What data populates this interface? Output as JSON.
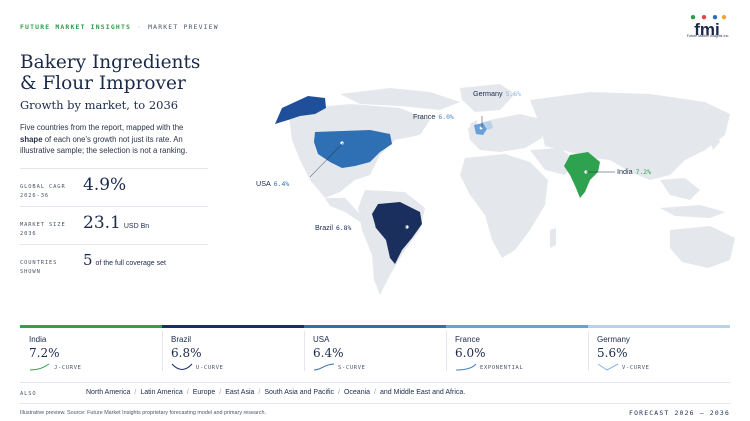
{
  "header": {
    "brand": "FUTURE MARKET INSIGHTS",
    "separator": "·",
    "section": "MARKET PREVIEW",
    "logo_text": "fmi",
    "logo_subtext": "Future Market Insights Inc."
  },
  "title": "Bakery Ingredients & Flour Improver",
  "subtitle": "Growth by market, to 2036",
  "description": {
    "part1": "Five countries from the report, mapped with the ",
    "bold": "shape",
    "part2": " of each one's growth not just its rate. An illustrative sample; the selection is not a ranking."
  },
  "stats": [
    {
      "label_line1": "GLOBAL CAGR",
      "label_line2": "2026-36",
      "value": "4.9%",
      "unit": ""
    },
    {
      "label_line1": "MARKET SIZE",
      "label_line2": "2036",
      "value": "23.1",
      "unit": "USD Bn"
    },
    {
      "label_line1": "COUNTRIES",
      "label_line2": "SHOWN",
      "value": "5",
      "unit": "of the full coverage set"
    }
  ],
  "map_labels": [
    {
      "name": "Germany",
      "value": "5.6%"
    },
    {
      "name": "France",
      "value": "6.0%"
    },
    {
      "name": "India",
      "value": "7.2%"
    },
    {
      "name": "USA",
      "value": "6.4%"
    },
    {
      "name": "Brazil",
      "value": "6.8%"
    }
  ],
  "countries": [
    {
      "name": "India",
      "value": "7.2%",
      "curve": "J-CURVE",
      "bar_color": "#2ea24e",
      "icon_color": "#2ea24e"
    },
    {
      "name": "Brazil",
      "value": "6.8%",
      "curve": "U-CURVE",
      "bar_color": "#1b2f5e",
      "icon_color": "#1b2f5e"
    },
    {
      "name": "USA",
      "value": "6.4%",
      "curve": "S-CURVE",
      "bar_color": "#2f6fb3",
      "icon_color": "#2f6fb3"
    },
    {
      "name": "France",
      "value": "6.0%",
      "curve": "EXPONENTIAL",
      "bar_color": "#6a9fd8",
      "icon_color": "#4a86c5"
    },
    {
      "name": "Germany",
      "value": "5.6%",
      "curve": "V-CURVE",
      "bar_color": "#b9d2ec",
      "icon_color": "#8fb5de"
    }
  ],
  "also": {
    "label": "ALSO",
    "regions": [
      "North America",
      "Latin America",
      "Europe",
      "East Asia",
      "South Asia and Pacific",
      "Oceania",
      "and Middle East and Africa."
    ]
  },
  "footer": {
    "source": "Illustrative preview. Source: Future Market Insights proprietary forecasting model and primary research.",
    "forecast": "FORECAST 2026 – 2036"
  },
  "colors": {
    "navy": "#1b2a4a",
    "green": "#2e9b4a",
    "land": "#e4e7ec",
    "india": "#2ea24e",
    "brazil": "#1b2f5e",
    "usa": "#2f6fb3",
    "france": "#6a9fd8",
    "germany": "#b9d2ec",
    "alaska": "#1f4f9a"
  }
}
